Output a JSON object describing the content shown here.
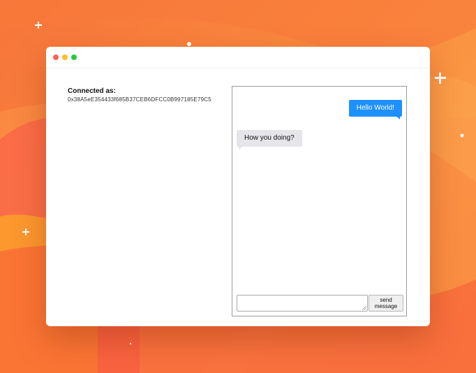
{
  "connected": {
    "label": "Connected as:",
    "address": "0x38A5eE354433f685B37CEB6DFCC0B997185E79C5"
  },
  "messages": [
    {
      "direction": "sent",
      "text": "Hello World!"
    },
    {
      "direction": "received",
      "text": "How you doing?"
    }
  ],
  "composer": {
    "input_value": "",
    "send_label": "send message"
  },
  "colors": {
    "sent_bubble": "#1e90ff",
    "received_bubble": "#e5e5ea",
    "window_close": "#fe5f57",
    "window_minimize": "#febc2e",
    "window_maximize": "#28c840"
  }
}
